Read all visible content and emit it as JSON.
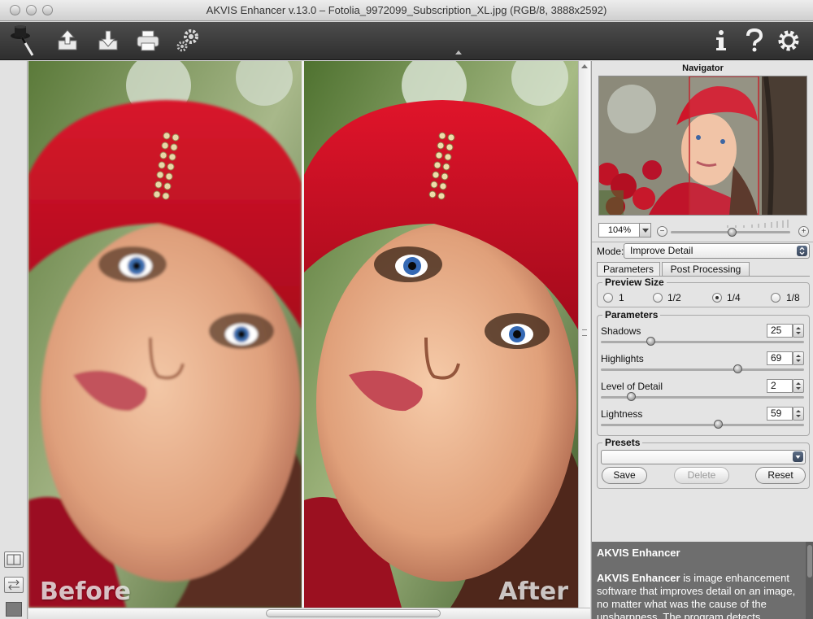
{
  "window": {
    "title": "AKVIS Enhancer v.13.0 – Fotolia_9972099_Subscription_XL.jpg (RGB/8, 3888x2592)"
  },
  "toolbar": {
    "left_icons": [
      "app-logo-icon",
      "open-upload-icon",
      "save-download-icon",
      "print-icon",
      "batch-gears-icon"
    ],
    "right_icons": [
      "info-icon",
      "help-icon",
      "settings-gear-icon"
    ]
  },
  "viewer": {
    "before_caption": "Before",
    "after_caption": "After"
  },
  "navigator": {
    "title": "Navigator",
    "zoom": "104%"
  },
  "mode": {
    "label": "Mode:",
    "value": "Improve Detail"
  },
  "tabs": [
    {
      "label": "Parameters",
      "active": true
    },
    {
      "label": "Post Processing",
      "active": false
    }
  ],
  "preview_size": {
    "title": "Preview Size",
    "options": [
      "1",
      "1/2",
      "1/4",
      "1/8"
    ],
    "selected": "1/4"
  },
  "parameters": {
    "title": "Parameters",
    "items": [
      {
        "label": "Shadows",
        "value": "25",
        "level": 0.25
      },
      {
        "label": "Highlights",
        "value": "69",
        "level": 0.69
      },
      {
        "label": "Level of Detail",
        "value": "2",
        "level": 0.15
      },
      {
        "label": "Lightness",
        "value": "59",
        "level": 0.59
      }
    ]
  },
  "presets": {
    "title": "Presets",
    "value": "",
    "save_label": "Save",
    "delete_label": "Delete",
    "reset_label": "Reset"
  },
  "info": {
    "title": "AKVIS Enhancer",
    "text_bold": "AKVIS Enhancer",
    "text_rest": " is image enhancement software that improves detail on an image, no matter what was the cause of the unsharpness. The program detects"
  },
  "colors": {
    "toolbar_bg": "#3a3a3a",
    "panel_bg": "#e4e4e4",
    "info_bg": "#6e6e6e",
    "select_accent": "#3e4a60"
  }
}
